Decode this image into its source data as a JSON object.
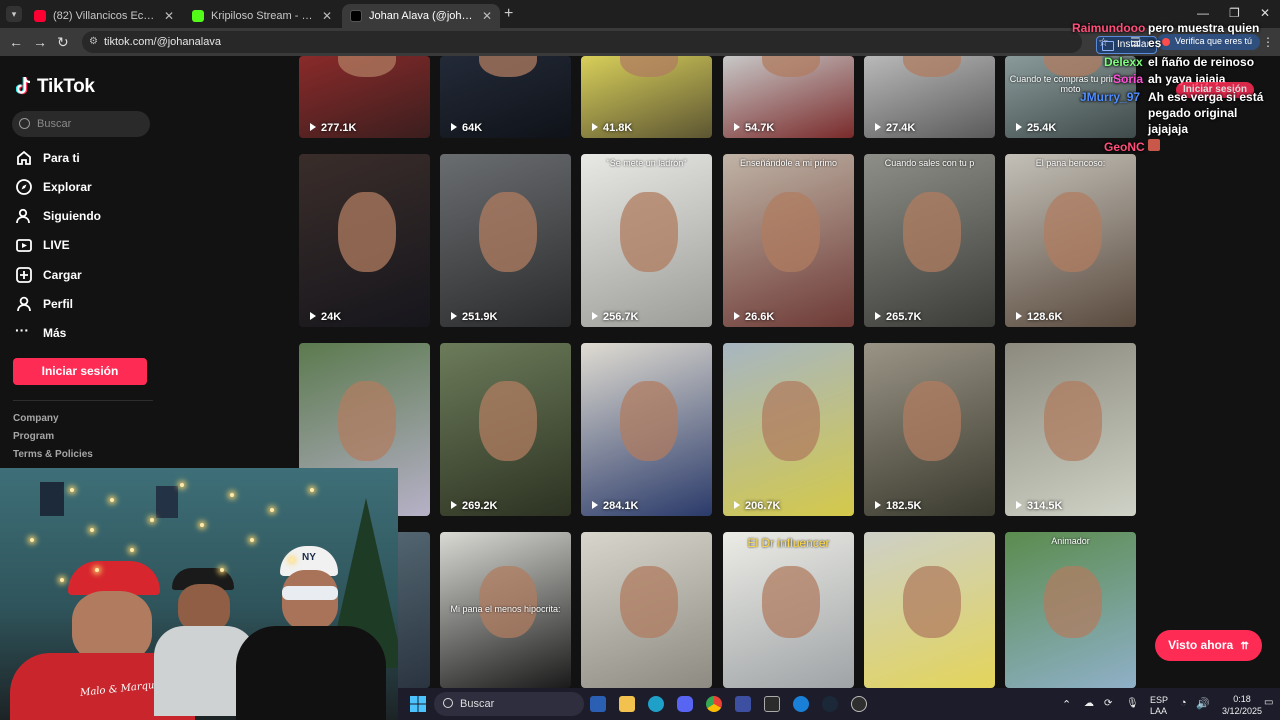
{
  "browser": {
    "tabs": [
      {
        "title": "(82) Villancicos Ecuatorianos M",
        "favicon_color": "#ff0033",
        "active": false
      },
      {
        "title": "Kripiloso Stream - Watch Live o",
        "favicon_color": "#53fc18",
        "active": false
      },
      {
        "title": "Johan Alava (@johanalava)",
        "favicon_color": "#000000",
        "active": true
      }
    ],
    "new_tab": "+",
    "url": "tiktok.com/@johanalava",
    "install_label": "Instalar",
    "verify_label": "Verifica que eres tú"
  },
  "sidebar": {
    "logo": "TikTok",
    "search_placeholder": "Buscar",
    "nav": [
      {
        "label": "Para ti",
        "icon": "home-icon"
      },
      {
        "label": "Explorar",
        "icon": "compass-icon"
      },
      {
        "label": "Siguiendo",
        "icon": "following-icon"
      },
      {
        "label": "LIVE",
        "icon": "live-icon"
      },
      {
        "label": "Cargar",
        "icon": "upload-icon"
      },
      {
        "label": "Perfil",
        "icon": "profile-icon"
      },
      {
        "label": "Más",
        "icon": "more-icon"
      }
    ],
    "login_label": "Iniciar sesión",
    "footer": [
      "Company",
      "Program",
      "Terms & Policies"
    ]
  },
  "videos": [
    {
      "views": "277.1K",
      "caption": ""
    },
    {
      "views": "64K",
      "caption": ""
    },
    {
      "views": "41.8K",
      "caption": ""
    },
    {
      "views": "54.7K",
      "caption": ""
    },
    {
      "views": "27.4K",
      "caption": ""
    },
    {
      "views": "25.4K",
      "caption": "Cuando te compras tu primera moto"
    },
    {
      "views": "24K",
      "caption": ""
    },
    {
      "views": "251.9K",
      "caption": ""
    },
    {
      "views": "256.7K",
      "caption": "\"Se mete un ladrón\""
    },
    {
      "views": "26.6K",
      "caption": "Enseñándole a mi primo"
    },
    {
      "views": "265.7K",
      "caption": "Cuando sales con tu p"
    },
    {
      "views": "128.6K",
      "caption": "El pana bencoso:"
    },
    {
      "views": "",
      "caption": ""
    },
    {
      "views": "269.2K",
      "caption": ""
    },
    {
      "views": "284.1K",
      "caption": ""
    },
    {
      "views": "206.7K",
      "caption": ""
    },
    {
      "views": "182.5K",
      "caption": ""
    },
    {
      "views": "314.5K",
      "caption": ""
    },
    {
      "views": "",
      "caption": ""
    },
    {
      "views": "",
      "caption": "Mi pana el menos hipocrita:"
    },
    {
      "views": "",
      "caption": ""
    },
    {
      "views": "",
      "caption": "El Dr influencer"
    },
    {
      "views": "",
      "caption": ""
    },
    {
      "views": "",
      "caption": "Animador"
    }
  ],
  "chat": [
    {
      "user": "Raimundooo",
      "user_color": "#ff4f7a",
      "message": "pero muestra quien es"
    },
    {
      "user": "Delexx",
      "user_color": "#7cff7c",
      "message": "el ñaño de reinoso"
    },
    {
      "user": "Soria",
      "user_color": "#ff4fd8",
      "message": "ah yaya jajaja"
    },
    {
      "user": "JMurry_97",
      "user_color": "#4f8dff",
      "message": "Ah ese verga si está pegado original jajajaja"
    },
    {
      "user": "GeoNC",
      "user_color": "#ff4f7a",
      "message": ""
    }
  ],
  "overlay_login": "Iniciar sesión",
  "webcam_shirt_text": "Malo & Marqueño",
  "watch_now_label": "Visto ahora",
  "taskbar": {
    "search_label": "Buscar",
    "language": "ESP",
    "layout": "LAA",
    "time": "0:18",
    "date": "3/12/2025"
  }
}
